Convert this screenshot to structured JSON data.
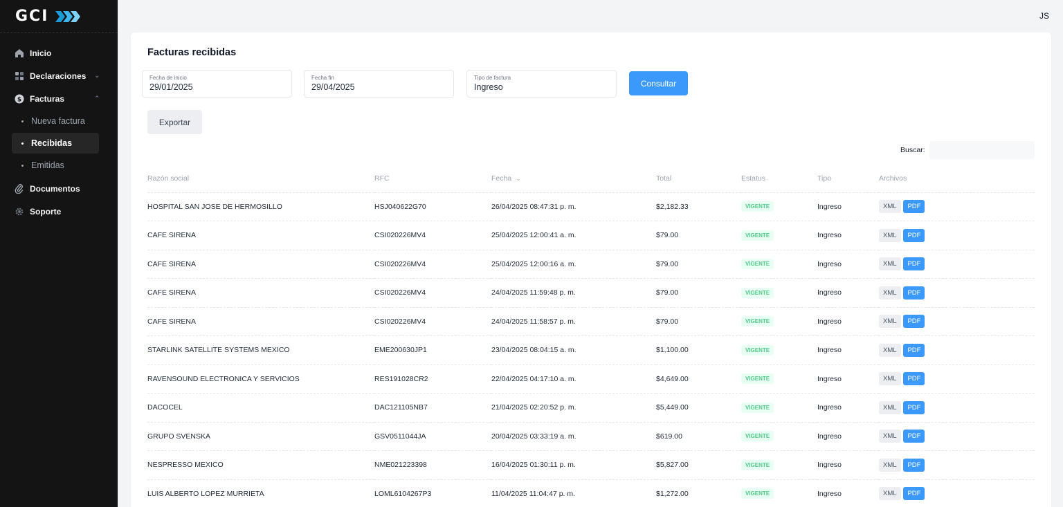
{
  "app": {
    "logo_text": "GCI",
    "user_initials": "JS"
  },
  "sidebar": {
    "items": [
      {
        "label": "Inicio",
        "icon": "home-icon"
      },
      {
        "label": "Declaraciones",
        "icon": "grid-icon",
        "expandable": true
      },
      {
        "label": "Facturas",
        "icon": "dollar-icon",
        "expandable": true,
        "expanded": true
      },
      {
        "label": "Documentos",
        "icon": "paperclip-icon"
      },
      {
        "label": "Soporte",
        "icon": "gear-icon"
      }
    ],
    "facturas_sub": [
      {
        "label": "Nueva factura",
        "active": false
      },
      {
        "label": "Recibidas",
        "active": true
      },
      {
        "label": "Emitidas",
        "active": false
      }
    ]
  },
  "page": {
    "title": "Facturas recibidas"
  },
  "filters": {
    "fecha_inicio": {
      "label": "Fecha de inicio",
      "value": "29/01/2025"
    },
    "fecha_fin": {
      "label": "Fecha fin",
      "value": "29/04/2025"
    },
    "tipo": {
      "label": "Tipo de factura",
      "value": "Ingreso"
    },
    "consultar_label": "Consultar",
    "exportar_label": "Exportar"
  },
  "search": {
    "label": "Buscar:",
    "value": ""
  },
  "table": {
    "columns": [
      "Razón social",
      "RFC",
      "Fecha",
      "Total",
      "Estatus",
      "Tipo",
      "Archivos"
    ],
    "rows": [
      {
        "razon": "HOSPITAL SAN JOSE DE HERMOSILLO",
        "rfc": "HSJ040622G70",
        "fecha": "26/04/2025 08:47:31 p. m.",
        "total": "$2,182.33",
        "estatus": "VIGENTE",
        "tipo": "Ingreso"
      },
      {
        "razon": "CAFE SIRENA",
        "rfc": "CSI020226MV4",
        "fecha": "25/04/2025 12:00:41 a. m.",
        "total": "$79.00",
        "estatus": "VIGENTE",
        "tipo": "Ingreso"
      },
      {
        "razon": "CAFE SIRENA",
        "rfc": "CSI020226MV4",
        "fecha": "25/04/2025 12:00:16 a. m.",
        "total": "$79.00",
        "estatus": "VIGENTE",
        "tipo": "Ingreso"
      },
      {
        "razon": "CAFE SIRENA",
        "rfc": "CSI020226MV4",
        "fecha": "24/04/2025 11:59:48 p. m.",
        "total": "$79.00",
        "estatus": "VIGENTE",
        "tipo": "Ingreso"
      },
      {
        "razon": "CAFE SIRENA",
        "rfc": "CSI020226MV4",
        "fecha": "24/04/2025 11:58:57 p. m.",
        "total": "$79.00",
        "estatus": "VIGENTE",
        "tipo": "Ingreso"
      },
      {
        "razon": "STARLINK SATELLITE SYSTEMS MEXICO",
        "rfc": "EME200630JP1",
        "fecha": "23/04/2025 08:04:15 a. m.",
        "total": "$1,100.00",
        "estatus": "VIGENTE",
        "tipo": "Ingreso"
      },
      {
        "razon": "RAVENSOUND ELECTRONICA Y SERVICIOS",
        "rfc": "RES191028CR2",
        "fecha": "22/04/2025 04:17:10 a. m.",
        "total": "$4,649.00",
        "estatus": "VIGENTE",
        "tipo": "Ingreso"
      },
      {
        "razon": "DACOCEL",
        "rfc": "DAC121105NB7",
        "fecha": "21/04/2025 02:20:52 p. m.",
        "total": "$5,449.00",
        "estatus": "VIGENTE",
        "tipo": "Ingreso"
      },
      {
        "razon": "GRUPO SVENSKA",
        "rfc": "GSV0511044JA",
        "fecha": "20/04/2025 03:33:19 a. m.",
        "total": "$619.00",
        "estatus": "VIGENTE",
        "tipo": "Ingreso"
      },
      {
        "razon": "NESPRESSO MEXICO",
        "rfc": "NME021223398",
        "fecha": "16/04/2025 01:30:11 p. m.",
        "total": "$5,827.00",
        "estatus": "VIGENTE",
        "tipo": "Ingreso"
      },
      {
        "razon": "LUIS ALBERTO LOPEZ MURRIETA",
        "rfc": "LOML6104267P3",
        "fecha": "11/04/2025 11:04:47 p. m.",
        "total": "$1,272.00",
        "estatus": "VIGENTE",
        "tipo": "Ingreso"
      }
    ],
    "file_buttons": {
      "xml": "XML",
      "pdf": "PDF"
    }
  },
  "colors": {
    "accent": "#3b99fc",
    "sidebar_bg": "#141414",
    "status_green": "#50cd89"
  }
}
